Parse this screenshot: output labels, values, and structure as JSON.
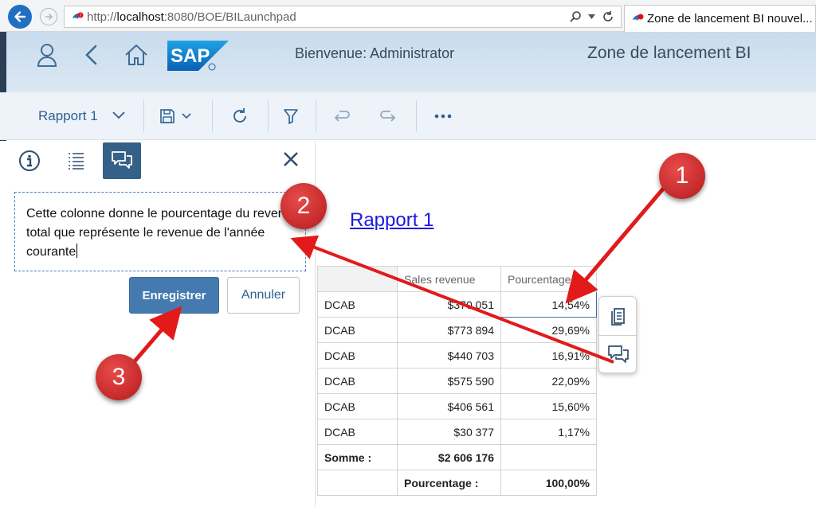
{
  "browser": {
    "url_prefix": "http://",
    "url_host": "localhost",
    "url_rest": ":8080/BOE/BILaunchpad",
    "tab_title": "Zone de lancement BI nouvel..."
  },
  "shell": {
    "welcome": "Bienvenue: Administrator",
    "app_title": "Zone de lancement BI",
    "logo_text": "SAP"
  },
  "toolbar": {
    "report_label": "Rapport 1"
  },
  "comment_panel": {
    "text": "Cette colonne donne le pourcentage du revenu total que représente le revenue de l'année courante",
    "save_label": "Enregistrer",
    "cancel_label": "Annuler"
  },
  "report": {
    "title": "Rapport 1",
    "headers": [
      "",
      "Sales revenue",
      "Pourcentage :"
    ],
    "rows": [
      [
        "DCAB",
        "$370 051",
        "14,54%"
      ],
      [
        "DCAB",
        "$773 894",
        "29,69%"
      ],
      [
        "DCAB",
        "$440 703",
        "16,91%"
      ],
      [
        "DCAB",
        "$575 590",
        "22,09%"
      ],
      [
        "DCAB",
        "$406 561",
        "15,60%"
      ],
      [
        "DCAB",
        "$30 377",
        "1,17%"
      ]
    ],
    "sum_label": "Somme :",
    "sum_value": "$2 606 176",
    "pct_label": "Pourcentage :",
    "pct_value": "100,00%"
  },
  "annotations": {
    "badge_1": "1",
    "badge_2": "2",
    "badge_3": "3",
    "color": "#e21a1a"
  }
}
